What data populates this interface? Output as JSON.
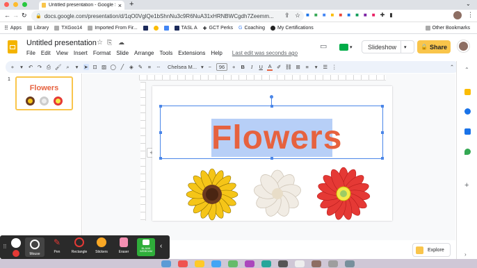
{
  "browser": {
    "tab_title": "Untitled presentation - Google Slides",
    "tab_close": "×",
    "new_tab": "+",
    "url": "docs.google.com/presentation/d/1qO0VglQe1bShnNu3c9R6NuA31xHRNBWCgdh7Zeemm...",
    "bookmarks": [
      "Apps",
      "Library",
      "TXGoo14",
      "Imported From Fir...",
      "",
      "",
      "TASL A",
      "GCT Perks",
      "Coaching",
      "My Certifications"
    ],
    "other_bookmarks": "Other Bookmarks"
  },
  "app": {
    "doc_title": "Untitled presentation",
    "menu": [
      "File",
      "Edit",
      "View",
      "Insert",
      "Format",
      "Slide",
      "Arrange",
      "Tools",
      "Extensions",
      "Help"
    ],
    "last_edit": "Last edit was seconds ago",
    "slideshow_label": "Slideshow",
    "share_label": "Share"
  },
  "toolbar": {
    "font_name": "Chelsea M...",
    "font_size": "96",
    "bold": "B",
    "italic": "I",
    "underline": "U",
    "text_color": "A"
  },
  "slides_panel": {
    "slide_number": "1",
    "thumb_title": "Flowers"
  },
  "slide": {
    "title": "Flowers",
    "title_color": "#e6623f"
  },
  "recorder": {
    "buttons": [
      "Mouse",
      "Pen",
      "Rectangle",
      "Stickers",
      "Eraser",
      "BLANK WEBCAM"
    ]
  },
  "explore_label": "Explore",
  "colors": {
    "accent_yellow": "#f9c54b",
    "selection_blue": "#4a86e8"
  }
}
